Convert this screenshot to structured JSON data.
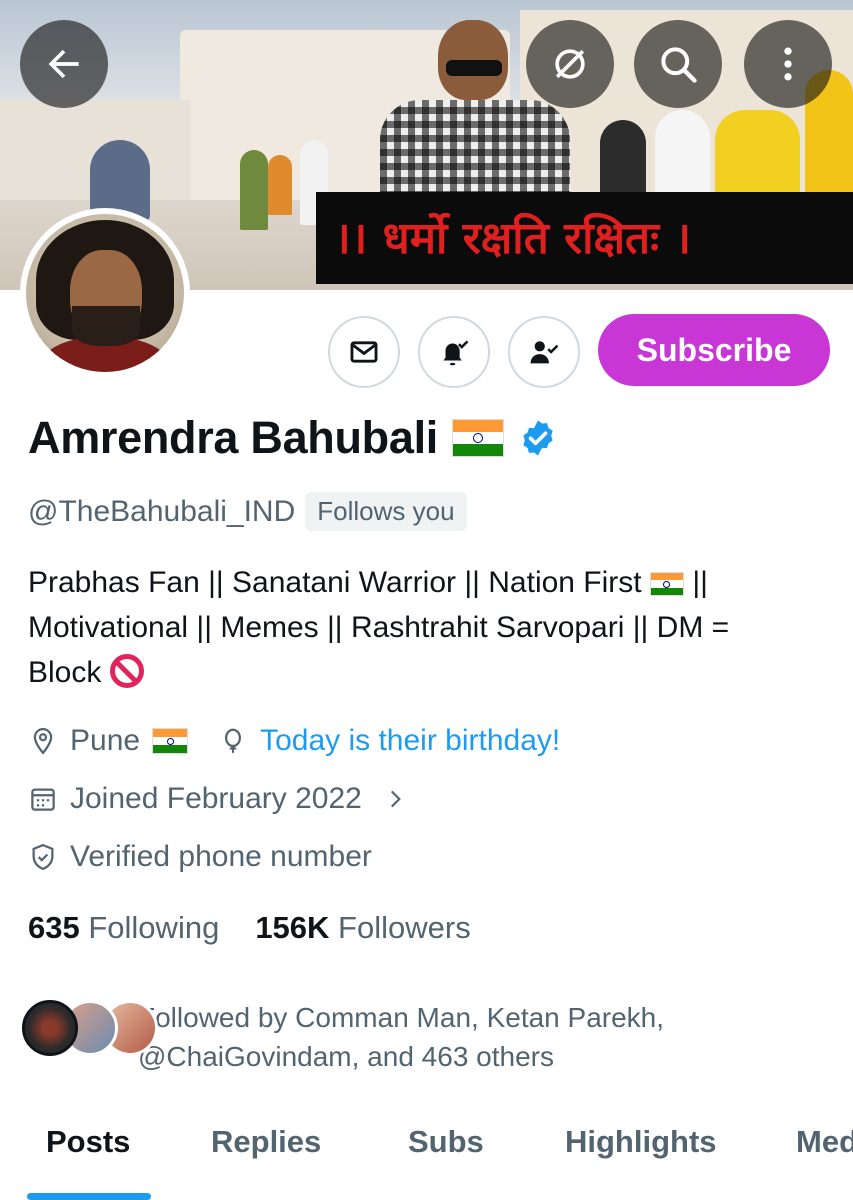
{
  "banner": {
    "overlay_text": "।। धर्मो रक्षति रक्षितः ।"
  },
  "nav": {
    "back_icon": "arrow-left-icon",
    "hide_icon": "eye-slash-icon",
    "search_icon": "search-icon",
    "more_icon": "more-vertical-icon"
  },
  "actions": {
    "message_icon": "envelope-icon",
    "notify_icon": "bell-check-icon",
    "following_icon": "person-check-icon",
    "subscribe_label": "Subscribe",
    "subscribe_color": "#c936d6"
  },
  "profile": {
    "name": "Amrendra Bahubali",
    "verified_icon": "verified-badge-icon",
    "handle": "@TheBahubali_IND",
    "follows_you": "Follows you",
    "bio": {
      "line1": "Prabhas Fan || Sanatani Warrior || Nation First",
      "line1_end": "||",
      "line2": "Motivational || Memes || Rashtrahit Sarvopari || DM =",
      "line3": "Block"
    },
    "location": "Pune",
    "birthday": "Today is their birthday!",
    "joined": "Joined February 2022",
    "verified_phone": "Verified phone number"
  },
  "stats": {
    "following_count": "635",
    "following_label": "Following",
    "followers_count": "156K",
    "followers_label": "Followers"
  },
  "followed_by": {
    "line1": "Followed by Comman Man, Ketan Parekh,",
    "line2": "@ChaiGovindam, and 463 others"
  },
  "tabs": [
    {
      "label": "Posts",
      "active": true
    },
    {
      "label": "Replies"
    },
    {
      "label": "Subs"
    },
    {
      "label": "Highlights"
    },
    {
      "label": "Med"
    }
  ],
  "colors": {
    "accent": "#1d9bf0",
    "text_secondary": "#536471"
  }
}
